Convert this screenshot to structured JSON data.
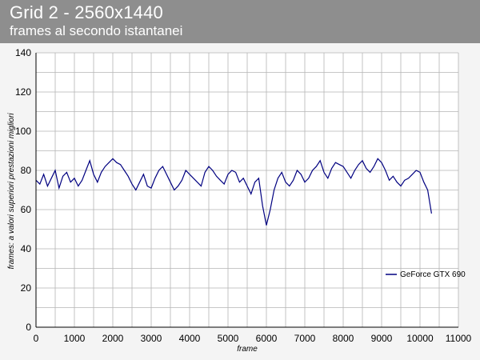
{
  "header": {
    "title": "Grid 2 - 2560x1440",
    "subtitle": "frames al secondo istantanei"
  },
  "colors": {
    "header_bg": "#8e8e8e",
    "series_line": "#000080",
    "grid": "#b4b4b4"
  },
  "chart_data": {
    "type": "line",
    "title": "Grid 2 - 2560x1440",
    "subtitle": "frames al secondo istantanei",
    "xlabel": "frame",
    "ylabel": "frames: a valori superiori prestazioni migliori",
    "xlim": [
      0,
      11000
    ],
    "ylim": [
      0,
      140
    ],
    "x_ticks": [
      0,
      1000,
      2000,
      3000,
      4000,
      5000,
      6000,
      7000,
      8000,
      9000,
      10000,
      11000
    ],
    "y_ticks": [
      0,
      20,
      40,
      60,
      80,
      100,
      120,
      140
    ],
    "grid": true,
    "legend_position": "right",
    "series": [
      {
        "name": "GeForce GTX 690",
        "color": "#000080",
        "x": [
          0,
          100,
          200,
          300,
          400,
          500,
          600,
          700,
          800,
          900,
          1000,
          1100,
          1200,
          1300,
          1400,
          1500,
          1600,
          1700,
          1800,
          1900,
          2000,
          2100,
          2200,
          2300,
          2400,
          2500,
          2600,
          2700,
          2800,
          2900,
          3000,
          3100,
          3200,
          3300,
          3400,
          3500,
          3600,
          3700,
          3800,
          3900,
          4000,
          4100,
          4200,
          4300,
          4400,
          4500,
          4600,
          4700,
          4800,
          4900,
          5000,
          5100,
          5200,
          5300,
          5400,
          5500,
          5600,
          5700,
          5800,
          5900,
          6000,
          6100,
          6200,
          6300,
          6400,
          6500,
          6600,
          6700,
          6800,
          6900,
          7000,
          7100,
          7200,
          7300,
          7400,
          7500,
          7600,
          7700,
          7800,
          7900,
          8000,
          8100,
          8200,
          8300,
          8400,
          8500,
          8600,
          8700,
          8800,
          8900,
          9000,
          9100,
          9200,
          9300,
          9400,
          9500,
          9600,
          9700,
          9800,
          9900,
          10000,
          10100,
          10200,
          10300
        ],
        "y": [
          75,
          73,
          78,
          72,
          76,
          80,
          71,
          77,
          79,
          74,
          76,
          72,
          75,
          80,
          85,
          78,
          74,
          79,
          82,
          84,
          86,
          84,
          83,
          80,
          77,
          73,
          70,
          74,
          78,
          72,
          71,
          76,
          80,
          82,
          78,
          74,
          70,
          72,
          75,
          80,
          78,
          76,
          74,
          72,
          79,
          82,
          80,
          77,
          75,
          73,
          78,
          80,
          79,
          74,
          76,
          72,
          68,
          74,
          76,
          62,
          52,
          60,
          70,
          76,
          79,
          74,
          72,
          75,
          80,
          78,
          74,
          76,
          80,
          82,
          85,
          79,
          76,
          81,
          84,
          83,
          82,
          79,
          76,
          80,
          83,
          85,
          81,
          79,
          82,
          86,
          84,
          80,
          75,
          77,
          74,
          72,
          75,
          76,
          78,
          80,
          79,
          74,
          70,
          58
        ]
      }
    ]
  }
}
